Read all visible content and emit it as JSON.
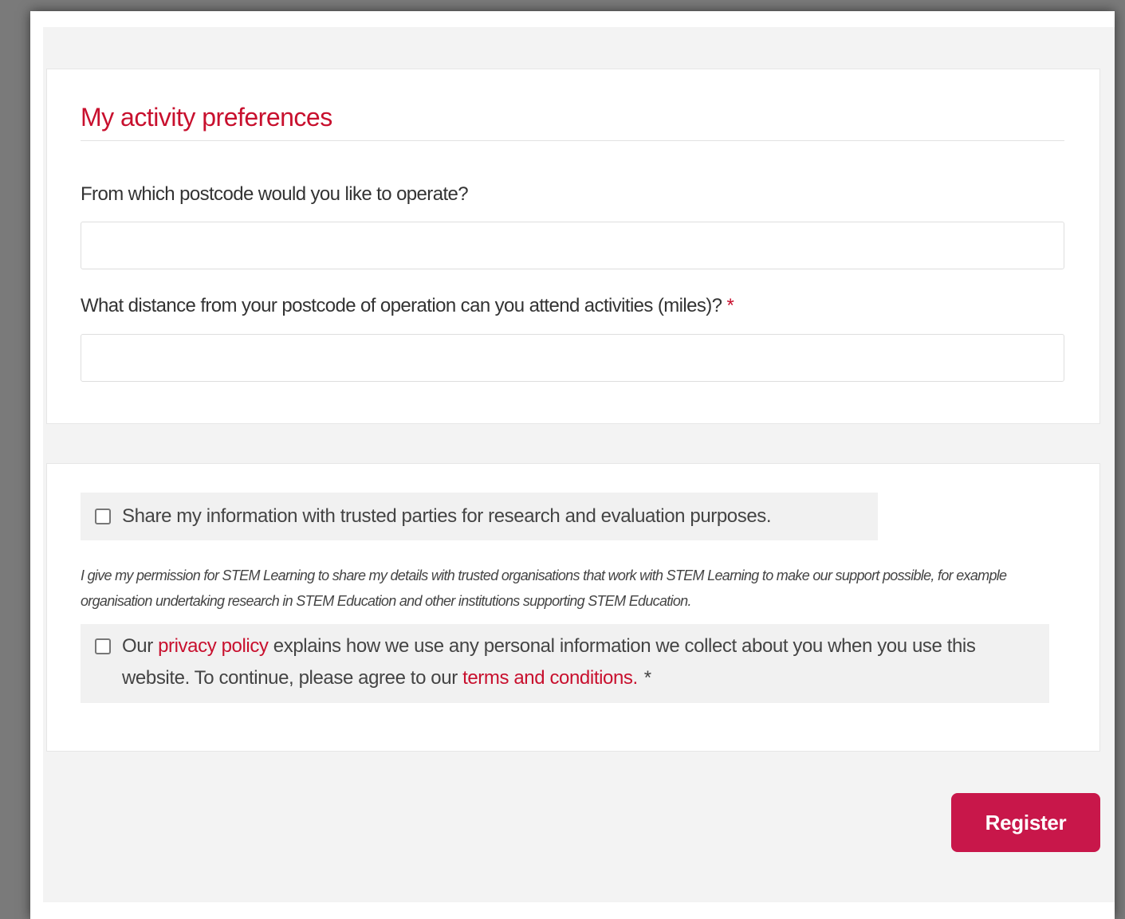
{
  "colors": {
    "accent": "#c8102e",
    "button": "#c8174a",
    "page_background": "#f3f3f3"
  },
  "preferences": {
    "title": "My activity preferences",
    "postcode_label": "From which postcode would you like to operate?",
    "postcode_value": "",
    "distance_label": "What distance from your postcode of operation can you attend activities (miles)?",
    "distance_required": "*",
    "distance_value": ""
  },
  "consent": {
    "share_label": "Share my information with trusted parties for research and evaluation purposes.",
    "share_checked": false,
    "permission_text": "I give my permission for STEM Learning to share my details with trusted organisations that work with STEM Learning to make our support possible, for example organisation undertaking research in STEM Education and other institutions supporting STEM Education.",
    "terms_checked": false,
    "terms_text": {
      "part1": "Our ",
      "privacy_link": "privacy policy",
      "part2": " explains how we use any personal information we collect about you when you use this website. To continue, please agree to our ",
      "terms_link": "terms and conditions.",
      "required": "*"
    }
  },
  "actions": {
    "register_label": "Register"
  }
}
